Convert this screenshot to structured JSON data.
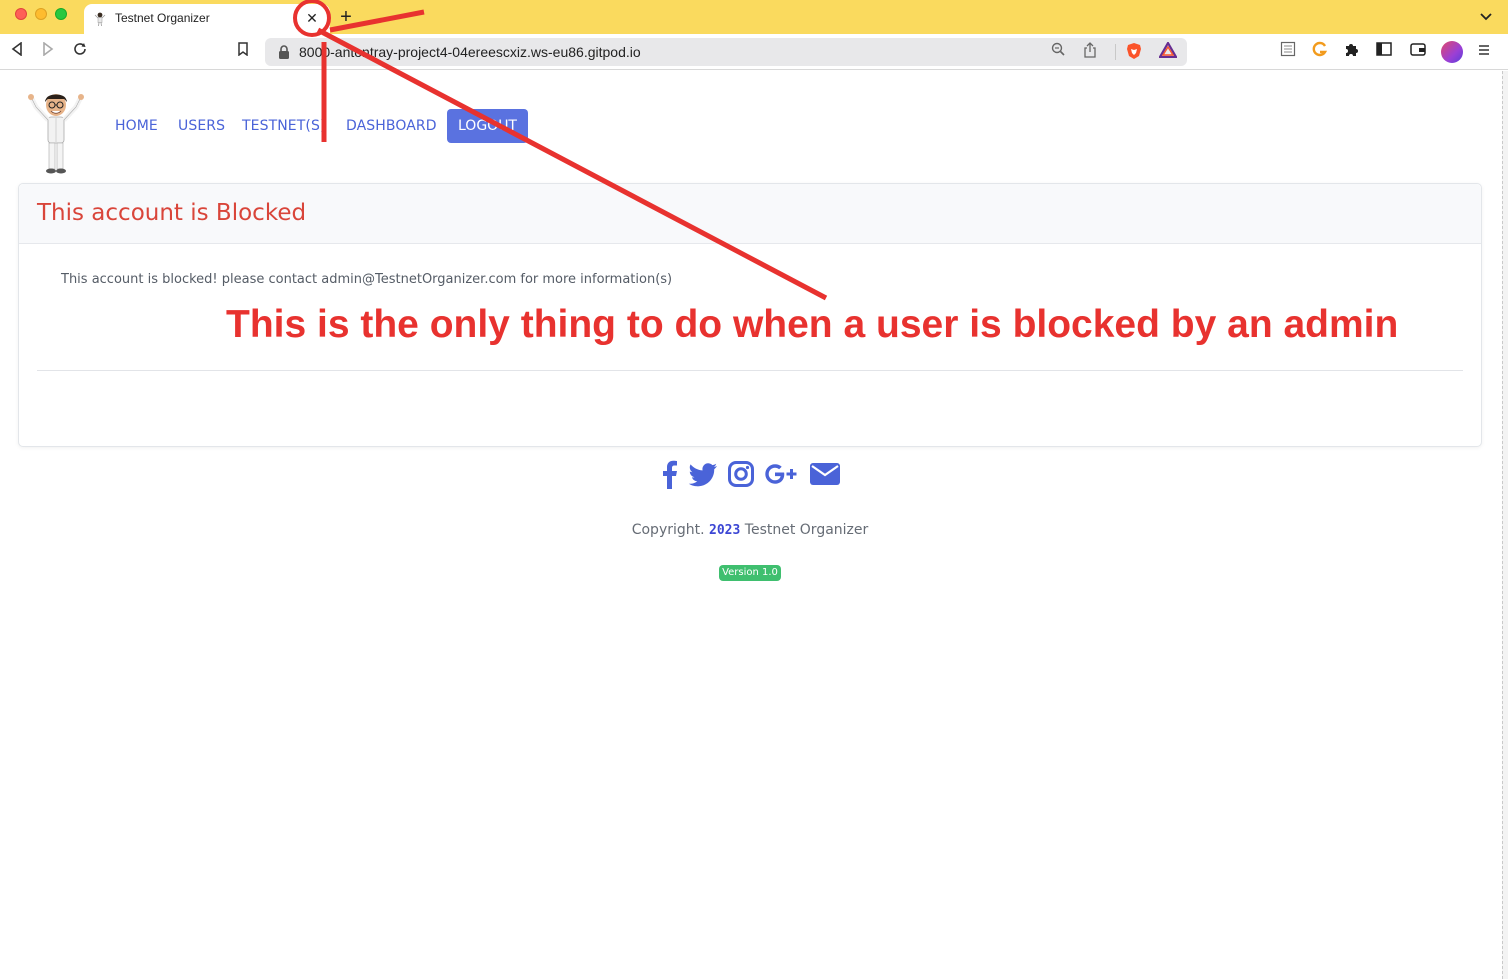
{
  "browser": {
    "tab_title": "Testnet Organizer",
    "tab_close_glyph": "✕",
    "new_tab_glyph": "+",
    "tab_list_glyph": "⌄",
    "url": "8000-antontray-project4-04ereescxiz.ws-eu86.gitpod.io",
    "icons": [
      "back-icon",
      "forward-icon",
      "reload-icon",
      "bookmark-icon",
      "lock-icon",
      "zoom-icon",
      "share-icon",
      "brave-shields-icon",
      "brave-rewards-icon",
      "reader-mode-icon",
      "grammarly-icon",
      "extensions-icon",
      "sidebar-icon",
      "wallet-icon",
      "profile-avatar",
      "menu-icon"
    ]
  },
  "nav": {
    "home": "HOME",
    "users": "USERS",
    "testnets": "TESTNET(S)",
    "dashboard": "DASHBOARD",
    "logout": "LOGOUT"
  },
  "card": {
    "title": "This account is Blocked",
    "message": "This account is blocked! please contact admin@TestnetOrganizer.com for more information(s)"
  },
  "annotation": {
    "text": "This is the only thing to do when a user is blocked by an admin",
    "color": "#e8322f"
  },
  "footer": {
    "social_icons": [
      "facebook-icon",
      "twitter-icon",
      "instagram-icon",
      "google-plus-icon",
      "envelope-icon"
    ],
    "copyright_prefix": "Copyright.",
    "copyright_year": "2023",
    "copyright_suffix": "Testnet Organizer",
    "version": "Version 1.0"
  },
  "colors": {
    "tab_strip": "#fada5e",
    "nav_link": "#4a63d8",
    "logout_bg": "#5a72e0",
    "card_title": "#d9453a",
    "version_badge": "#3fbf6f"
  }
}
